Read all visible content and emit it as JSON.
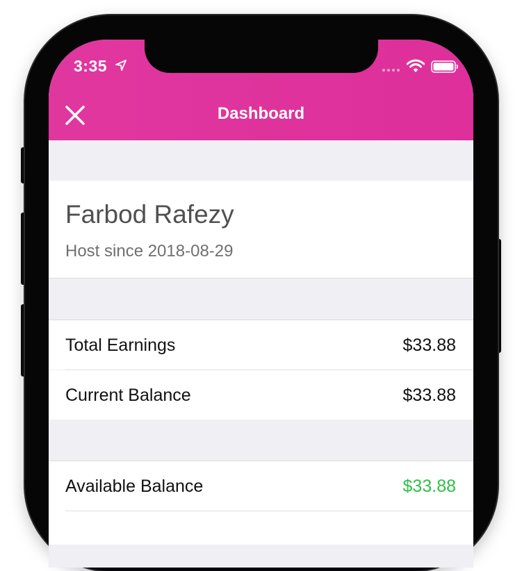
{
  "status_bar": {
    "time": "3:35",
    "icons": [
      "location-arrow-icon",
      "signal-dots-icon",
      "wifi-icon",
      "battery-icon"
    ]
  },
  "nav": {
    "title": "Dashboard",
    "close_icon": "close-icon"
  },
  "profile": {
    "name": "Farbod Rafezy",
    "host_since": "Host since 2018-08-29"
  },
  "earnings": {
    "items": [
      {
        "label": "Total Earnings",
        "value": "$33.88"
      },
      {
        "label": "Current Balance",
        "value": "$33.88"
      }
    ]
  },
  "balance": {
    "items": [
      {
        "label": "Available Balance",
        "value": "$33.88"
      }
    ]
  },
  "colors": {
    "header": "#de2f9a",
    "positive": "#2fc046",
    "background": "#efeff4"
  }
}
